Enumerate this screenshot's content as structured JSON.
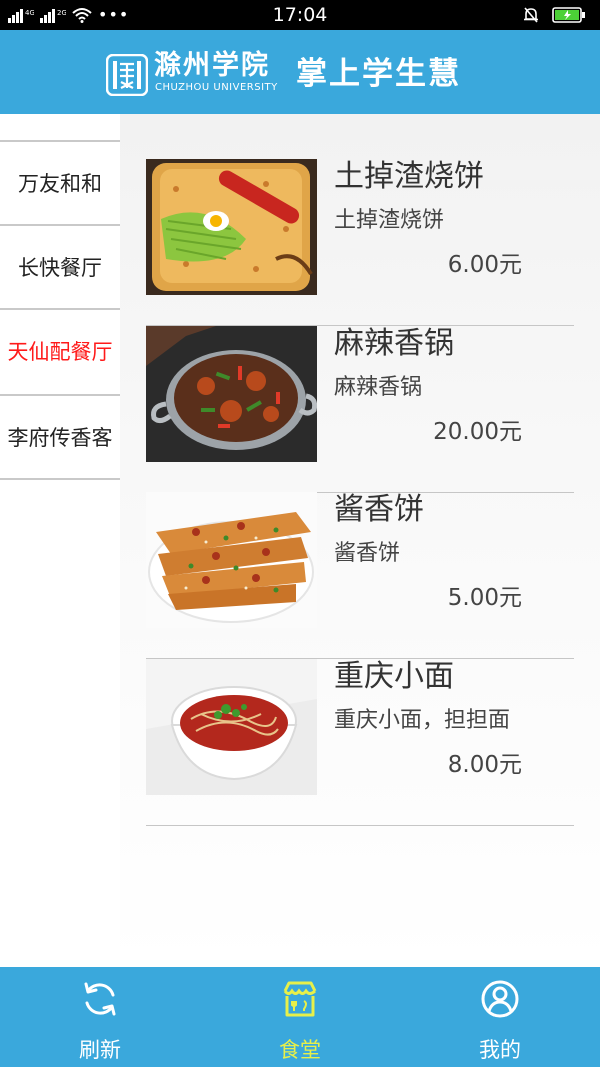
{
  "status_bar": {
    "time": "17:04",
    "network_left": "4G",
    "network_right": "2G",
    "battery_color": "#4cd137"
  },
  "header": {
    "university_name": "滁州学院",
    "university_english": "CHUZHOU UNIVERSITY",
    "app_title": "掌上学生慧",
    "background_color": "#3aa8dc"
  },
  "sidebar": {
    "items": [
      {
        "label": "万友和和",
        "active": false
      },
      {
        "label": "长快餐厅",
        "active": false
      },
      {
        "label": "天仙配餐厅",
        "active": true
      },
      {
        "label": "李府传香客",
        "active": false
      }
    ],
    "active_color": "#ff1a1a"
  },
  "menu": {
    "items": [
      {
        "name": "土掉渣烧饼",
        "description": "土掉渣烧饼",
        "price": "6.00元",
        "image": "flatbread-with-sausage"
      },
      {
        "name": "麻辣香锅",
        "description": "麻辣香锅",
        "price": "20.00元",
        "image": "spicy-stir-fry-pot"
      },
      {
        "name": "酱香饼",
        "description": "酱香饼",
        "price": "5.00元",
        "image": "sauce-pancake"
      },
      {
        "name": "重庆小面",
        "description": "重庆小面，担担面",
        "price": "8.00元",
        "image": "chongqing-noodle-bowl"
      }
    ]
  },
  "bottom_nav": {
    "items": [
      {
        "label": "刷新",
        "icon": "refresh-icon",
        "active": false
      },
      {
        "label": "食堂",
        "icon": "canteen-icon",
        "active": true
      },
      {
        "label": "我的",
        "icon": "profile-icon",
        "active": false
      }
    ],
    "active_color": "#e7f04a"
  }
}
